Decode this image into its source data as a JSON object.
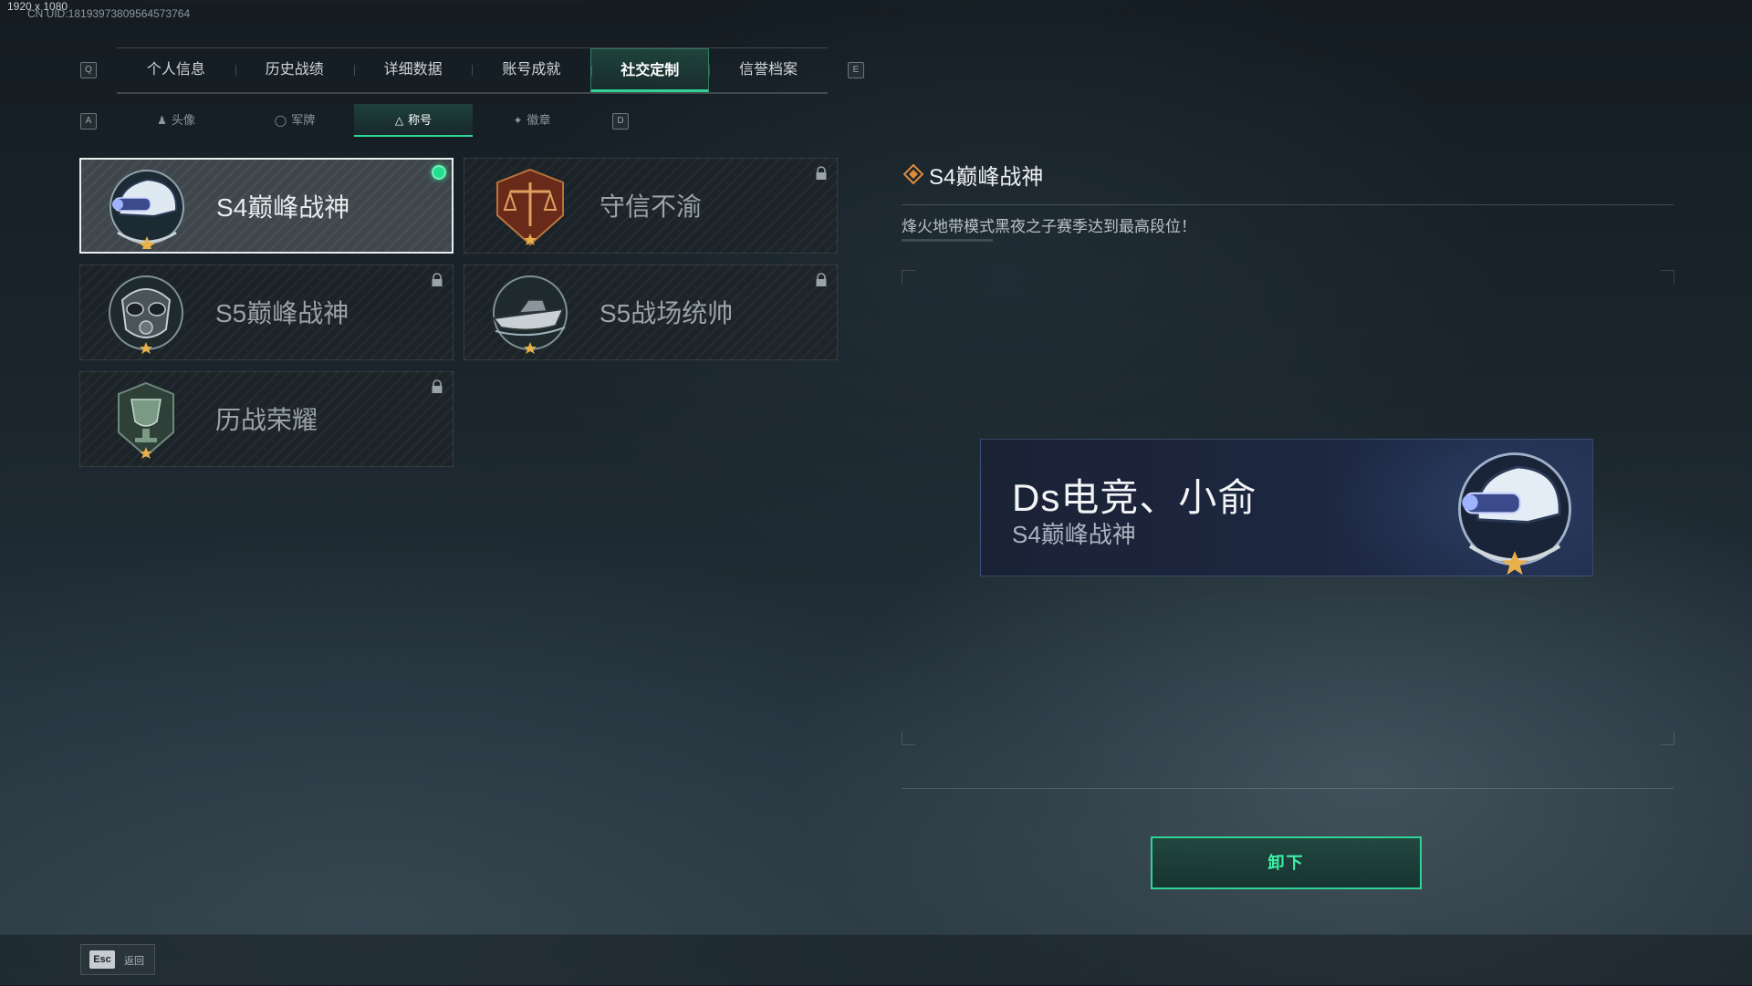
{
  "overlay": {
    "resolution": "1920 x 1080",
    "uid": "CN UID:18193973809564573764"
  },
  "keys": {
    "prev_tab": "Q",
    "next_tab": "E",
    "prev_sub": "A",
    "next_sub": "D"
  },
  "tabs": [
    {
      "label": "个人信息",
      "active": false
    },
    {
      "label": "历史战绩",
      "active": false
    },
    {
      "label": "详细数据",
      "active": false
    },
    {
      "label": "账号成就",
      "active": false
    },
    {
      "label": "社交定制",
      "active": true
    },
    {
      "label": "信誉档案",
      "active": false
    }
  ],
  "subtabs": [
    {
      "label": "头像",
      "icon": "person-icon",
      "active": false
    },
    {
      "label": "军牌",
      "icon": "dogtag-icon",
      "active": false
    },
    {
      "label": "称号",
      "icon": "title-icon",
      "active": true
    },
    {
      "label": "徽章",
      "icon": "badge-icon",
      "active": false
    }
  ],
  "titles": [
    {
      "name": "S4巅峰战神",
      "emblem": "nightvision-helmet-icon",
      "selected": true,
      "equipped": true,
      "locked": false
    },
    {
      "name": "守信不渝",
      "emblem": "scales-shield-icon",
      "selected": false,
      "equipped": false,
      "locked": true
    },
    {
      "name": "S5巅峰战神",
      "emblem": "gasmask-icon",
      "selected": false,
      "equipped": false,
      "locked": true
    },
    {
      "name": "S5战场统帅",
      "emblem": "speedboat-icon",
      "selected": false,
      "equipped": false,
      "locked": true
    },
    {
      "name": "历战荣耀",
      "emblem": "trophy-icon",
      "selected": false,
      "equipped": false,
      "locked": true
    }
  ],
  "detail": {
    "title": "S4巅峰战神",
    "description": "烽火地带模式黑夜之子赛季达到最高段位！"
  },
  "nameplate": {
    "player_name": "Ds电竞、小俞",
    "title": "S4巅峰战神",
    "emblem": "nightvision-helmet-icon"
  },
  "actions": {
    "unequip": "卸下"
  },
  "footer": {
    "esc_key": "Esc",
    "esc_label": "返回"
  },
  "colors": {
    "accent": "#2fd495",
    "equipped_dot": "#22e08f",
    "star": "#e8b04a"
  }
}
